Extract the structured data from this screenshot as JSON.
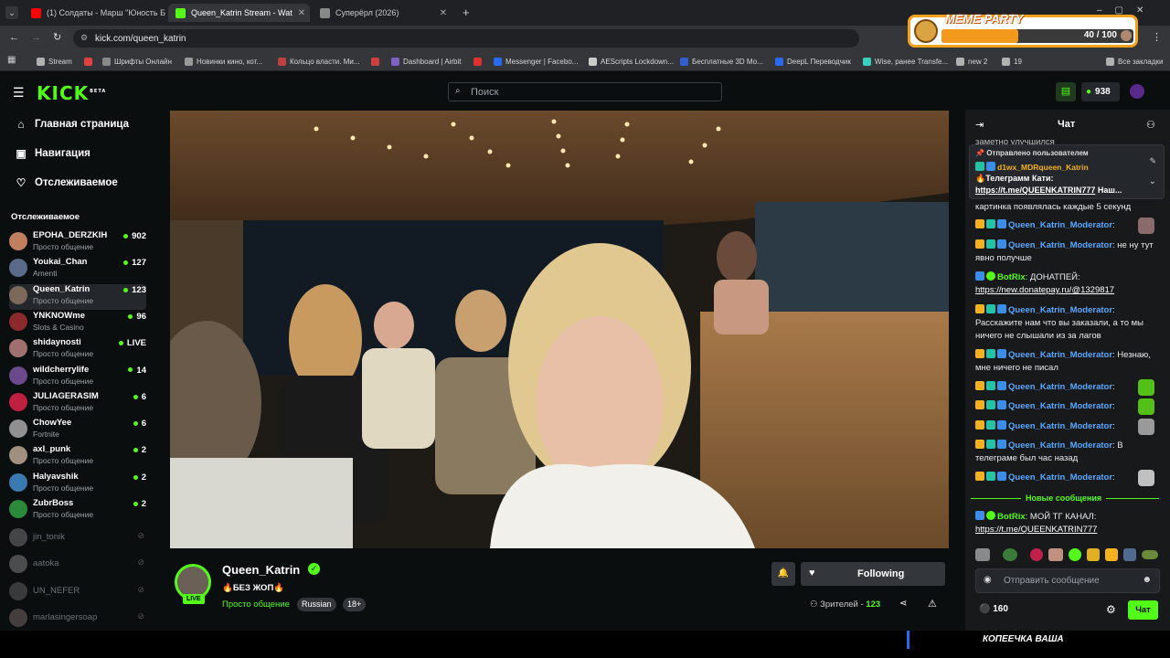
{
  "browser": {
    "tabs": [
      {
        "title": "(1) Солдаты - Марш \"Юность Б",
        "color": "#ff0000"
      },
      {
        "title": "Queen_Katrin Stream - Wat",
        "color": "#53fc18"
      },
      {
        "title": "Суперёрл (2026)",
        "color": "#888888"
      }
    ],
    "url": "kick.com/queen_katrin",
    "bookmarks": [
      "Stream",
      "",
      "Шрифты Онлайн",
      "Новинки кино, кот...",
      "Кольцо власти. Ми...",
      "",
      "Dashboard | Airbit",
      "",
      "Messenger | Facebo...",
      "AEScripts Lockdown...",
      "Бесплатные 3D Мо...",
      "DeepL Переводчик",
      "Wise, ранее Transfe...",
      "new 2",
      "19",
      "Все закладки"
    ],
    "meme": {
      "title": "MEME PARTY",
      "progress": "40 / 100",
      "fraction": 0.4
    }
  },
  "header": {
    "logo": "KICK",
    "beta": "BETA",
    "search_placeholder": "Поиск",
    "points": "938"
  },
  "sidebar": {
    "nav": [
      {
        "label": "Главная страница",
        "icon": "home-icon"
      },
      {
        "label": "Навигация",
        "icon": "compass-icon"
      },
      {
        "label": "Отслеживаемое",
        "icon": "heart-icon"
      }
    ],
    "following_title": "Отслеживаемое",
    "channels": [
      {
        "name": "EPOHA_DERZKIH",
        "cat": "Просто общение",
        "viewers": "902",
        "color": "#c08060"
      },
      {
        "name": "Youkai_Chan",
        "cat": "Amenti",
        "viewers": "127",
        "color": "#5a6b8a"
      },
      {
        "name": "Queen_Katrin",
        "cat": "Просто общение",
        "viewers": "123",
        "color": "#7b6a5a"
      },
      {
        "name": "YNKNOWme",
        "cat": "Slots & Casino",
        "viewers": "96",
        "color": "#8a2a2a"
      },
      {
        "name": "shidaynosti",
        "cat": "Просто общение",
        "viewers": "LIVE",
        "color": "#a07070"
      },
      {
        "name": "wildcherrylife",
        "cat": "Просто общение",
        "viewers": "14",
        "color": "#6a4a8a"
      },
      {
        "name": "JULIAGERASIM",
        "cat": "Просто общение",
        "viewers": "6",
        "color": "#c02040"
      },
      {
        "name": "ChowYee",
        "cat": "Fortnite",
        "viewers": "6",
        "color": "#909090"
      },
      {
        "name": "axl_punk",
        "cat": "Просто общение",
        "viewers": "2",
        "color": "#a09080"
      },
      {
        "name": "Halyavshik",
        "cat": "Просто общение",
        "viewers": "2",
        "color": "#3a7ab0"
      },
      {
        "name": "ZubrBoss",
        "cat": "Просто общение",
        "viewers": "2",
        "color": "#2a8a3a"
      }
    ],
    "offline": [
      {
        "name": "jin_tonik",
        "color": "#8a8a8a"
      },
      {
        "name": "aatoka",
        "color": "#9a9a9a"
      },
      {
        "name": "UN_NEFER",
        "color": "#707070"
      },
      {
        "name": "marlasingersoap",
        "color": "#8a7a7a"
      }
    ]
  },
  "stream": {
    "channel": "Queen_Katrin",
    "live": "LIVE",
    "title": "БЕЗ ЖОП",
    "category": "Просто общение",
    "tags": [
      "Russian",
      "18+"
    ],
    "follow_label": "Following",
    "viewers_label": "Зрителей - ",
    "viewers": "123"
  },
  "chat": {
    "title": "Чат",
    "partial_top": "заметно улучшился",
    "pinned": {
      "label": "Отправлено пользователем",
      "user": "d1wx_MDRqueen_Katrin",
      "line1": "Телеграмм Кати:",
      "link": "https://t.me/QUEENKATRIN777",
      "tail": " Наш..."
    },
    "after_pin": "картинка появлялась каждые 5 секунд",
    "messages": [
      {
        "user": "Queen_Katrin_Moderator",
        "text": ":"
      },
      {
        "user": "Queen_Katrin_Moderator",
        "text": ": не ну тут явно получше"
      },
      {
        "user": "BotRix",
        "text": ": ДОНАТПЕЙ:",
        "link": "https://new.donatepay.ru/@1329817"
      },
      {
        "user": "Queen_Katrin_Moderator",
        "text": ": Расскажите нам что вы заказали, а то мы ничего не слышали из за лагов"
      },
      {
        "user": "Queen_Katrin_Moderator",
        "text": ": Незнаю, мне ничего не писал"
      },
      {
        "user": "Queen_Katrin_Moderator",
        "text": ":"
      },
      {
        "user": "Queen_Katrin_Moderator",
        "text": ":"
      },
      {
        "user": "Queen_Katrin_Moderator",
        "text": ":"
      },
      {
        "user": "Queen_Katrin_Moderator",
        "text": ": В телеграме был час назад"
      },
      {
        "user": "Queen_Katrin_Moderator",
        "text": ":"
      }
    ],
    "new_messages": "Новые сообщения",
    "last": {
      "user": "BotRix",
      "text": ": МОЙ ТГ КАНАЛ:",
      "link": "https://t.me/QUEENKATRIN777"
    },
    "input_placeholder": "Отправить сообщение",
    "points": "160",
    "send_label": "Чат"
  },
  "overlay_text": "КОПЕЕЧКА ВАША"
}
